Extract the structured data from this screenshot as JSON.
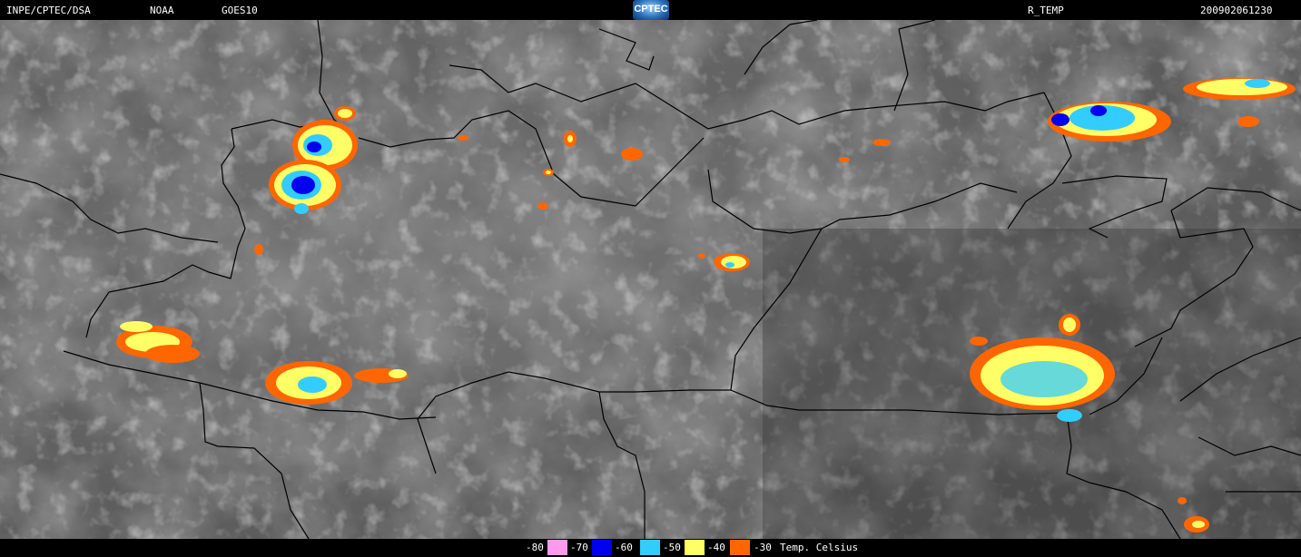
{
  "header": {
    "source": "INPE/CPTEC/DSA",
    "agency": "NOAA",
    "satellite": "GOES10",
    "logo": "CPTEC",
    "product": "R_TEMP",
    "datetime": "200902061230"
  },
  "legend": {
    "unit_label": "Temp. Celsius",
    "entries": [
      {
        "label": "-80",
        "color": "#ff99ee"
      },
      {
        "label": "-70",
        "color": "#0000ee"
      },
      {
        "label": "-60",
        "color": "#33ccff"
      },
      {
        "label": "-50",
        "color": "#ffff66"
      },
      {
        "label": "-40",
        "color": "#ff6600"
      },
      {
        "label": "-30",
        "color": "#000000"
      }
    ]
  },
  "colors": {
    "background": "#000000",
    "cloud_base": "#5a5a5a",
    "border_line": "#000000"
  }
}
